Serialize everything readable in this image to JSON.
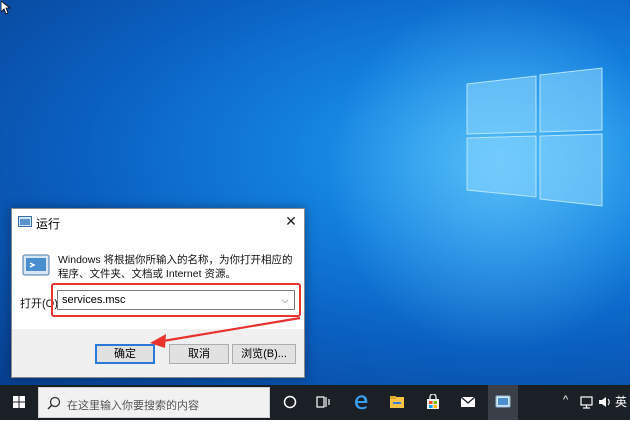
{
  "dialog": {
    "title": "运行",
    "close_glyph": "✕",
    "description": "Windows 将根据你所输入的名称，为你打开相应的程序、文件夹、文档或 Internet 资源。",
    "open_label": "打开(O):",
    "command_value": "services.msc",
    "ok_label": "确定",
    "cancel_label": "取消",
    "browse_label": "浏览(B)..."
  },
  "taskbar": {
    "search_placeholder": "在这里输入你要搜索的内容",
    "ime_label": "英",
    "tray_chevron": "^"
  },
  "colors": {
    "annotation": "#e8332e",
    "taskbar": "#1b1f26"
  },
  "icons": [
    "windows-logo-icon",
    "cursor-icon",
    "run-app-icon",
    "search-icon",
    "task-view-icon",
    "edge-icon",
    "file-explorer-icon",
    "store-icon",
    "mail-icon",
    "run-taskbar-icon",
    "network-icon",
    "volume-icon"
  ]
}
